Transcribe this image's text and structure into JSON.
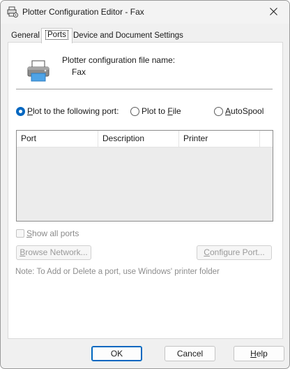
{
  "window": {
    "title": "Plotter Configuration Editor - Fax"
  },
  "tabs": [
    {
      "label": "General"
    },
    {
      "label": "Ports"
    },
    {
      "label": "Device and Document Settings"
    }
  ],
  "config": {
    "label": "Plotter configuration file name:",
    "value": "Fax"
  },
  "port_options": [
    {
      "label": "Plot to the following port:",
      "accel": "P",
      "rest": "lot to the following port:",
      "selected": true
    },
    {
      "label": "Plot to File",
      "pre": "Plot to ",
      "accel": "F",
      "rest": "ile",
      "selected": false
    },
    {
      "label": "AutoSpool",
      "accel": "A",
      "rest": "utoSpool",
      "selected": false
    }
  ],
  "ports_table": {
    "columns": [
      "Port",
      "Description",
      "Printer"
    ],
    "rows": []
  },
  "show_all": {
    "label": "Show all ports",
    "accel": "S",
    "rest": "how all ports",
    "checked": false,
    "enabled": false
  },
  "buttons": {
    "browse": {
      "label": "Browse Network...",
      "accel": "B",
      "rest": "rowse Network..."
    },
    "configure": {
      "label": "Configure Port...",
      "accel": "C",
      "rest": "onfigure Port..."
    }
  },
  "note": "Note: To Add or Delete a port, use Windows' printer folder",
  "footer": {
    "ok": "OK",
    "cancel": "Cancel",
    "help": {
      "label": "Help",
      "accel": "H",
      "rest": "elp"
    }
  },
  "colors": {
    "accent": "#0067c0",
    "panel": "#ffffff",
    "frame": "#f0f0f0",
    "disabled_text": "#9a9a9a"
  },
  "icons": [
    "plotter-config-icon",
    "close-icon",
    "printer-icon"
  ]
}
